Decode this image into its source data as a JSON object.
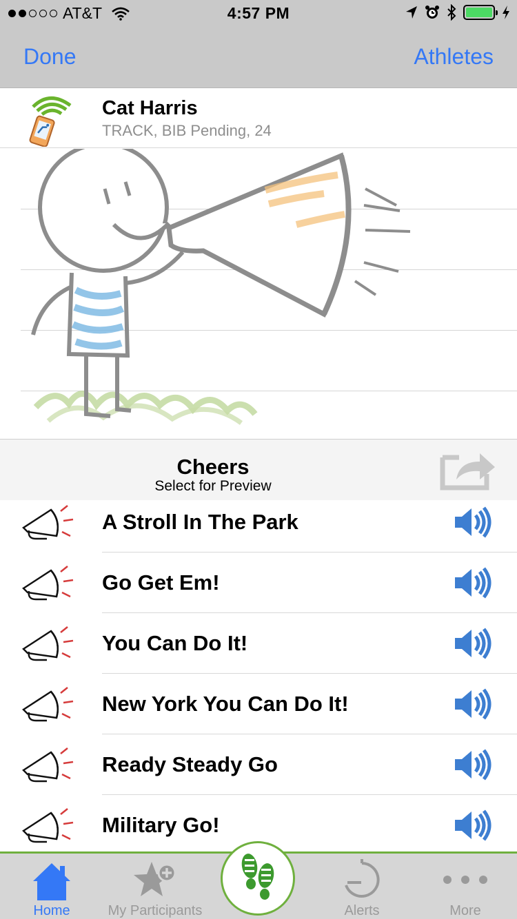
{
  "status_bar": {
    "carrier": "AT&T",
    "time": "4:57 PM",
    "battery_color": "#4cd964"
  },
  "nav": {
    "left_button": "Done",
    "right_button": "Athletes",
    "accent_color": "#3478f6"
  },
  "athlete": {
    "name": "Cat Harris",
    "details": "TRACK, BIB Pending, 24",
    "icon": "tracking-phone-icon"
  },
  "cheers": {
    "title": "Cheers",
    "subtitle": "Select for Preview",
    "share_icon": "share-icon",
    "items": [
      {
        "label": "A Stroll In The Park",
        "icon": "megaphone-icon",
        "action_icon": "speaker-icon"
      },
      {
        "label": "Go Get Em!",
        "icon": "megaphone-icon",
        "action_icon": "speaker-icon"
      },
      {
        "label": "You Can Do It!",
        "icon": "megaphone-icon",
        "action_icon": "speaker-icon"
      },
      {
        "label": "New York You Can Do It!",
        "icon": "megaphone-icon",
        "action_icon": "speaker-icon"
      },
      {
        "label": "Ready Steady Go",
        "icon": "megaphone-icon",
        "action_icon": "speaker-icon"
      },
      {
        "label": "Military Go!",
        "icon": "megaphone-icon",
        "action_icon": "speaker-icon"
      }
    ]
  },
  "tabbar": {
    "tabs": [
      {
        "label": "Home",
        "icon": "home-icon",
        "active": true
      },
      {
        "label": "My Participants",
        "icon": "star-plus-icon",
        "active": false
      },
      {
        "label": "",
        "icon": "footprints-icon",
        "active": false
      },
      {
        "label": "Alerts",
        "icon": "timer-icon",
        "active": false
      },
      {
        "label": "More",
        "icon": "more-icon",
        "active": false
      }
    ],
    "accent_color": "#6fb03e"
  }
}
